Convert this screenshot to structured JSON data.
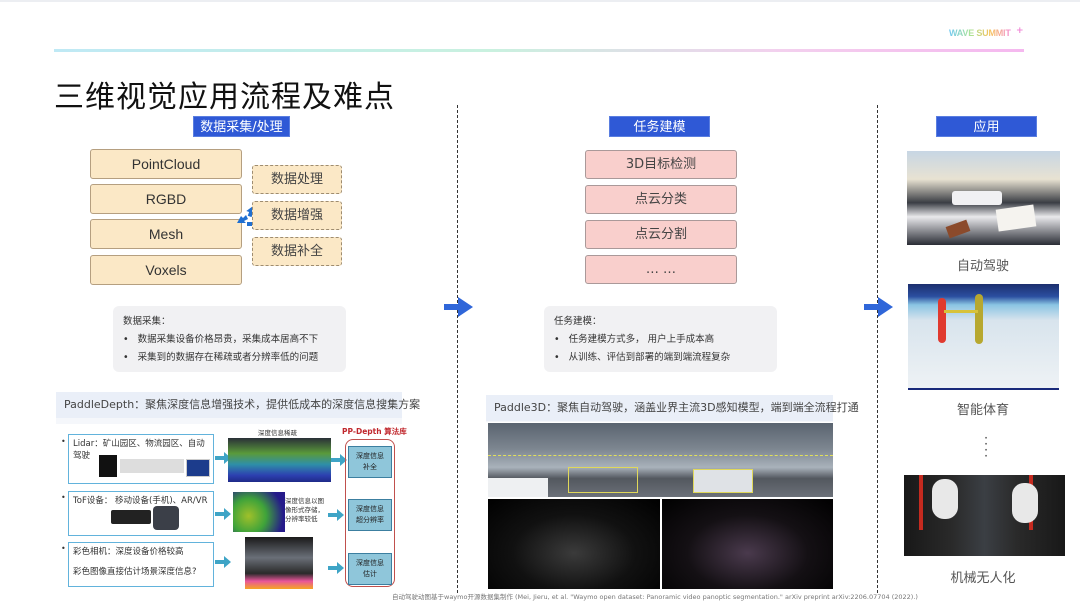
{
  "brand": {
    "name": "WAVE SUMMIT",
    "plus": "+"
  },
  "title": "三维视觉应用流程及难点",
  "sections": {
    "data": {
      "header": "数据采集/处理",
      "sources": [
        "PointCloud",
        "RGBD",
        "Mesh",
        "Voxels"
      ],
      "processing": [
        "数据处理",
        "数据增强",
        "数据补全"
      ],
      "note": {
        "title": "数据采集：",
        "bullets": [
          "数据采集设备价格昂贵，采集成本居高不下",
          "采集到的数据存在稀疏或者分辨率低的问题"
        ]
      }
    },
    "task": {
      "header": "任务建模",
      "tasks": [
        "3D目标检测",
        "点云分类",
        "点云分割",
        "… …"
      ],
      "note": {
        "title": "任务建模：",
        "bullets": [
          "任务建模方式多， 用户上手成本高",
          "从训练、评估到部署的端到端流程复杂"
        ]
      }
    },
    "app": {
      "header": "应用",
      "items": [
        {
          "caption": "自动驾驶",
          "image": "autonomous-car-interior"
        },
        {
          "caption": "智能体育",
          "image": "figure-skating-pose"
        },
        {
          "caption": "机械无人化",
          "image": "robotic-arms"
        }
      ],
      "ellipsis": "⋮"
    }
  },
  "paddle_depth": {
    "header": "PaddleDepth：聚焦深度信息增强技术，提供低成本的深度信息搜集方案",
    "library_label": "PP-Depth 算法库",
    "sparse_label": "深度信息稀疏",
    "lowres_label": "深度信息以图像形式存储，分辨率较低",
    "devices": [
      {
        "text": "Lidar：矿山园区、物流园区、自动驾驶"
      },
      {
        "text": "ToF设备： 移动设备(手机)、AR/VR"
      },
      {
        "text": "彩色相机：深度设备价格较高",
        "text2": "彩色图像直接估计场景深度信息?"
      }
    ],
    "algorithms": [
      "深度信息\n补全",
      "深度信息\n超分辨率",
      "深度信息\n估计"
    ]
  },
  "paddle3d": {
    "header": "Paddle3D：聚焦自动驾驶，涵盖业界主流3D感知模型，端到端全流程打通"
  },
  "citation": "自动驾驶动图基于waymo开源数据集制作 (Mei, Jieru, et al. \"Waymo open dataset: Panoramic video panoptic segmentation.\" arXiv preprint arXiv:2206.07704 (2022).)",
  "colors": {
    "section_header": "#2f59d6",
    "source_box": "#fbe8c6",
    "task_box": "#f9cfcc",
    "arrow": "#2f66d9",
    "algo_box": "#8fc6da"
  }
}
